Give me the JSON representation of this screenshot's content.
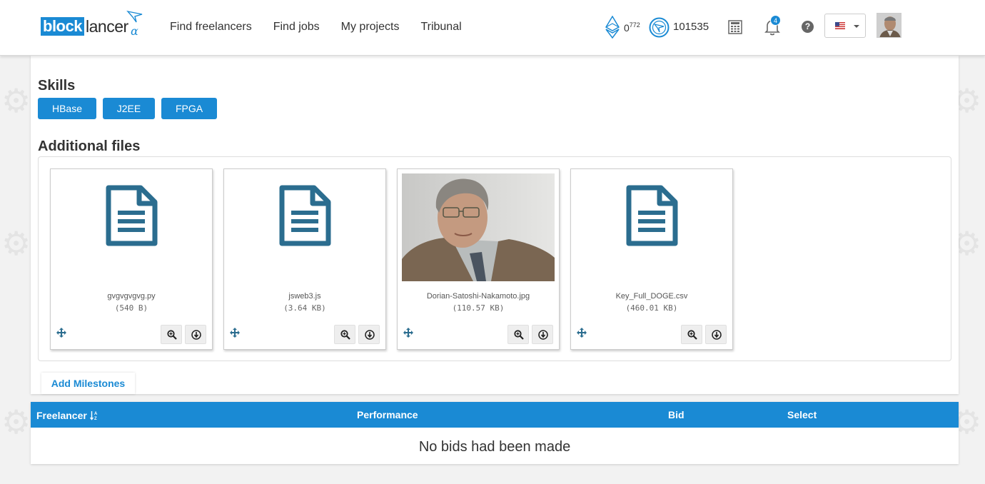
{
  "header": {
    "logo_block": "block",
    "logo_lancer": "lancer",
    "logo_alpha": "α",
    "nav": [
      "Find freelancers",
      "Find jobs",
      "My projects",
      "Tribunal"
    ],
    "eth_value": "0",
    "eth_decimals": "772",
    "token_value": "101535",
    "notifications_count": "4",
    "help_glyph": "?",
    "language_flag": "us-flag-icon"
  },
  "skills": {
    "title": "Skills",
    "items": [
      "HBase",
      "J2EE",
      "FPGA"
    ]
  },
  "files": {
    "title": "Additional files",
    "items": [
      {
        "name": "gvgvgvgvg.py",
        "size": "(540 B)",
        "type": "document"
      },
      {
        "name": "jsweb3.js",
        "size": "(3.64 KB)",
        "type": "document"
      },
      {
        "name": "Dorian-Satoshi-Nakamoto.jpg",
        "size": "(110.57 KB)",
        "type": "image"
      },
      {
        "name": "Key_Full_DOGE.csv",
        "size": "(460.01 KB)",
        "type": "document"
      }
    ]
  },
  "milestones": {
    "add_label": "Add Milestones"
  },
  "bids": {
    "columns": [
      "Freelancer",
      "Performance",
      "Bid",
      "Select"
    ],
    "sort_icon": "sort-alpha-icon",
    "empty_message": "No bids had been made"
  },
  "colors": {
    "accent": "#1a8ad4",
    "file_icon": "#2b6d8f"
  }
}
